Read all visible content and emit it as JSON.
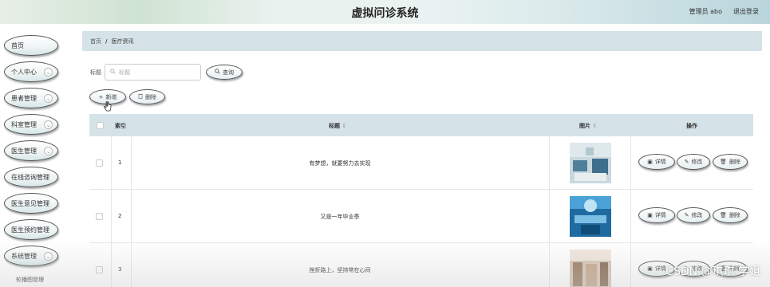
{
  "header": {
    "title": "虚拟问诊系统",
    "admin": "管理员 abo",
    "logout": "退出登录"
  },
  "sidebar": {
    "items": [
      {
        "label": "首页",
        "has_chevron": false
      },
      {
        "label": "个人中心",
        "has_chevron": true
      },
      {
        "label": "患者管理",
        "has_chevron": true
      },
      {
        "label": "科室管理",
        "has_chevron": true
      },
      {
        "label": "医生管理",
        "has_chevron": true
      },
      {
        "label": "在线咨询管理",
        "has_chevron": false
      },
      {
        "label": "医生意见管理",
        "has_chevron": false
      },
      {
        "label": "医生预约管理",
        "has_chevron": false
      },
      {
        "label": "系统管理",
        "has_chevron": true
      }
    ],
    "sub_item": "轮播图管理"
  },
  "breadcrumb": {
    "home": "首页",
    "separator": "/",
    "current": "医疗资讯"
  },
  "search": {
    "label": "标题",
    "placeholder": "标题",
    "button": "查询"
  },
  "toolbar": {
    "add": "新增",
    "delete": "删除"
  },
  "table": {
    "headers": {
      "index": "索引",
      "title": "标题",
      "image": "图片",
      "actions": "操作"
    },
    "rows": [
      {
        "index": "1",
        "title": "有梦想，就要努力去实现"
      },
      {
        "index": "2",
        "title": "又是一年毕业季"
      },
      {
        "index": "3",
        "title": "挫折路上，坚持常在心间"
      }
    ],
    "action_labels": {
      "detail": "详情",
      "edit": "修改",
      "delete": "删除"
    }
  },
  "watermark": "CSDN @琪琪 学姐",
  "icons": {
    "search": "search-icon",
    "add": "plus-icon",
    "delete": "trash-icon",
    "detail": "detail-icon",
    "edit": "edit-icon",
    "sort": "sort-icon",
    "chevron": "chevron-down-icon",
    "cursor": "hand-cursor-icon"
  },
  "colors": {
    "header_bg": "#d8e8ea",
    "breadcrumb_bg": "#d5e3e8",
    "table_header_bg": "#d5e3e8"
  }
}
